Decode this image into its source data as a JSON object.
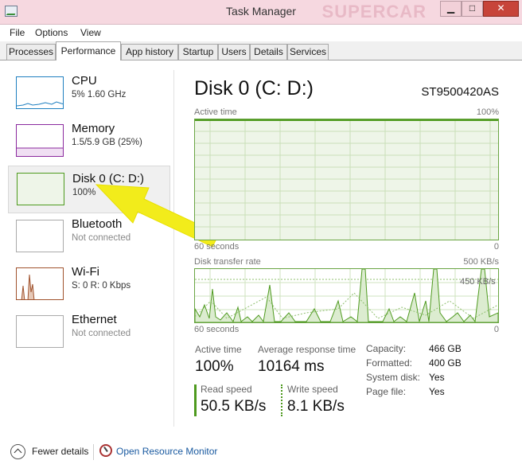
{
  "window": {
    "title": "Task Manager",
    "minimize_glyph": "▁",
    "maximize_glyph": "□",
    "close_glyph": "✕"
  },
  "menu": {
    "file": "File",
    "options": "Options",
    "view": "View"
  },
  "tabs": [
    {
      "label": "Processes"
    },
    {
      "label": "Performance"
    },
    {
      "label": "App history"
    },
    {
      "label": "Startup"
    },
    {
      "label": "Users"
    },
    {
      "label": "Details"
    },
    {
      "label": "Services"
    }
  ],
  "active_tab": "Performance",
  "resources": [
    {
      "name": "CPU",
      "sub": "5% 1.60 GHz",
      "color": "#1e7fc0"
    },
    {
      "name": "Memory",
      "sub": "1.5/5.9 GB (25%)",
      "color": "#8b2a9e"
    },
    {
      "name": "Disk 0 (C: D:)",
      "sub": "100%",
      "color": "#4e9a1f",
      "selected": true
    },
    {
      "name": "Bluetooth",
      "sub": "Not connected",
      "color": "#999999"
    },
    {
      "name": "Wi-Fi",
      "sub": "S: 0 R: 0 Kbps",
      "color": "#a0522d"
    },
    {
      "name": "Ethernet",
      "sub": "Not connected",
      "color": "#999999"
    }
  ],
  "detail": {
    "title": "Disk 0 (C: D:)",
    "model": "ST9500420AS",
    "active_time_graph": {
      "label": "Active time",
      "max_label": "100%",
      "xlabel": "60 seconds",
      "min_label": "0",
      "value_percent": 100
    },
    "transfer_graph": {
      "label": "Disk transfer rate",
      "max_label": "500 KB/s",
      "inner_label": "450 KB/s",
      "xlabel": "60 seconds",
      "min_label": "0"
    },
    "stats": {
      "active_time_label": "Active time",
      "active_time_value": "100%",
      "avg_response_label": "Average response time",
      "avg_response_value": "10164 ms",
      "read_label": "Read speed",
      "read_value": "50.5 KB/s",
      "write_label": "Write speed",
      "write_value": "8.1 KB/s"
    },
    "properties": [
      {
        "key": "Capacity:",
        "value": "466 GB"
      },
      {
        "key": "Formatted:",
        "value": "400 GB"
      },
      {
        "key": "System disk:",
        "value": "Yes"
      },
      {
        "key": "Page file:",
        "value": "Yes"
      }
    ]
  },
  "bottom": {
    "fewer_details": "Fewer details",
    "open_resource_monitor": "Open Resource Monitor"
  },
  "colors": {
    "disk_green": "#4e9a1f",
    "disk_fill": "#eef5e8",
    "annotation_arrow": "#f2ec1b",
    "titlebar": "#f6d8e0"
  }
}
